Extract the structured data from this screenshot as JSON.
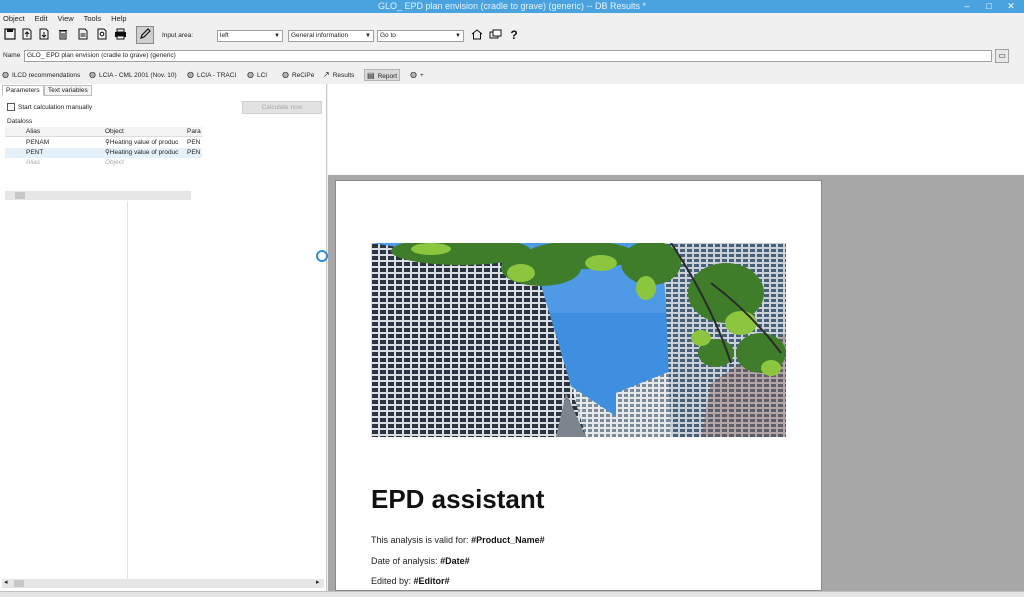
{
  "window": {
    "title": "GLO_ EPD plan envision (cradle to grave) (generic) -- DB Results *",
    "minimize": "–",
    "maximize": "□",
    "close": "✕"
  },
  "menu": [
    "Object",
    "Edit",
    "View",
    "Tools",
    "Help"
  ],
  "toolbar": {
    "input_area_label": "Input area:",
    "input_area_value": "left",
    "section_value": "General information",
    "goto_value": "Go to",
    "help_glyph": "?"
  },
  "name_field": {
    "label": "Name",
    "value": "GLO_ EPD plan envision (cradle to grave) (generic)",
    "button_glyph": "▭"
  },
  "doc_tabs": [
    {
      "label": "ILCD recommendations"
    },
    {
      "label": "LCIA - CML 2001 (Nov. 10)"
    },
    {
      "label": "LCIA - TRACI"
    },
    {
      "label": "LCI"
    },
    {
      "label": "ReCiPe"
    },
    {
      "label": "Results"
    },
    {
      "label": "Report"
    },
    {
      "label": "+"
    }
  ],
  "left_panel": {
    "tabs": [
      "Parameters",
      "Text variables"
    ],
    "start_calc_label": "Start calculation manually",
    "calculate_button": "Calculate now",
    "section_label": "Dataloss",
    "columns": [
      "Alias",
      "Object",
      "Para"
    ],
    "rows": [
      {
        "alias": "PENAM",
        "object": "Heating value of produc",
        "param": "PEN"
      },
      {
        "alias": "PENT",
        "object": "Heating value of produc",
        "param": "PEN"
      },
      {
        "alias": "Alias",
        "object": "Object",
        "param": ""
      }
    ],
    "scroll_left": "◂",
    "scroll_right": "▸"
  },
  "report": {
    "title": "EPD assistant",
    "valid_for_label": "This analysis is valid for:",
    "valid_for_value": "#Product_Name#",
    "date_label": "Date of analysis:",
    "date_value": "#Date#",
    "edited_label": "Edited by:",
    "edited_value": "#Editor#"
  },
  "colors": {
    "titlebar": "#4aa3df",
    "canvas_gray": "#a7a7a7",
    "spinner": "#2a8fd6"
  }
}
